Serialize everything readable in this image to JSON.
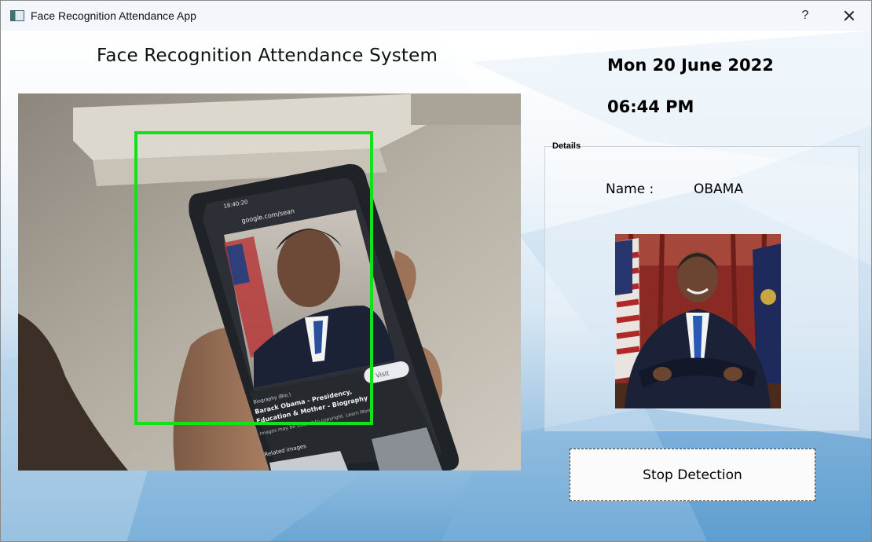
{
  "window": {
    "title": "Face Recognition Attendance App",
    "help_label": "?",
    "icons": {
      "app": "app-window-icon",
      "close": "close-icon"
    }
  },
  "main": {
    "system_title": "Face Recognition Attendance System",
    "date": "Mon 20 June 2022",
    "time": "06:44 PM"
  },
  "camera": {
    "detection_box_color": "#14e01c",
    "phone_screen": {
      "time": "18:40:20",
      "url": "google.com/sean",
      "visit": "Visit",
      "source_tag": "Biography (Bio.)",
      "headline_1": "Barack Obama - Presidency,",
      "headline_2": "Education & Mother - Biography",
      "copyright_note": "Images may be subject to copyright. Learn More",
      "related": "Related images"
    }
  },
  "details": {
    "legend": "Details",
    "name_label": "Name :",
    "name_value": "OBAMA"
  },
  "actions": {
    "stop_label": "Stop Detection"
  },
  "colors": {
    "accent_green": "#14e01c",
    "background_blue": "#6aa6d3"
  }
}
